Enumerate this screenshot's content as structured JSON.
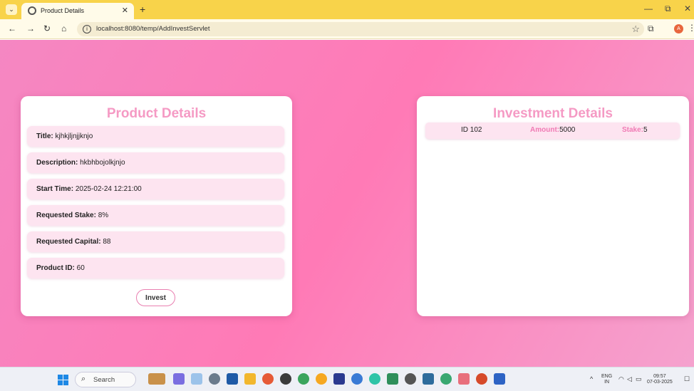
{
  "browser": {
    "tab_title": "Product Details",
    "url": "localhost:8080/temp/AddInvestServlet",
    "avatar_letter": "A"
  },
  "product": {
    "heading": "Product Details",
    "fields": [
      {
        "label": "Title:",
        "value": " kjhkjljnjjknjo"
      },
      {
        "label": "Description:",
        "value": " hkbhbojolkjnjo"
      },
      {
        "label": "Start Time:",
        "value": " 2025-02-24 12:21:00"
      },
      {
        "label": "Requested Stake:",
        "value": " 8%"
      },
      {
        "label": "Requested Capital:",
        "value": " 88"
      },
      {
        "label": "Product ID:",
        "value": " 60"
      }
    ],
    "invest_label": "Invest"
  },
  "investments": {
    "heading": "Investment Details",
    "rows": [
      {
        "id": "ID 102",
        "amount_label": "Amount:",
        "amount": "5000",
        "stake_label": "Stake:",
        "stake": "5"
      }
    ]
  },
  "taskbar": {
    "search_label": "Search",
    "lang_top": "ENG",
    "lang_bottom": "IN",
    "time": "09:57",
    "date": "07-03-2025"
  },
  "colors": {
    "page_gradient_start": "#f587c2",
    "page_gradient_mid": "#ff7ab6",
    "heading_pink": "#f59ac4",
    "row_bg": "#fde4f0",
    "key_pink": "#f07ab4",
    "tabbar": "#f8d34a"
  }
}
